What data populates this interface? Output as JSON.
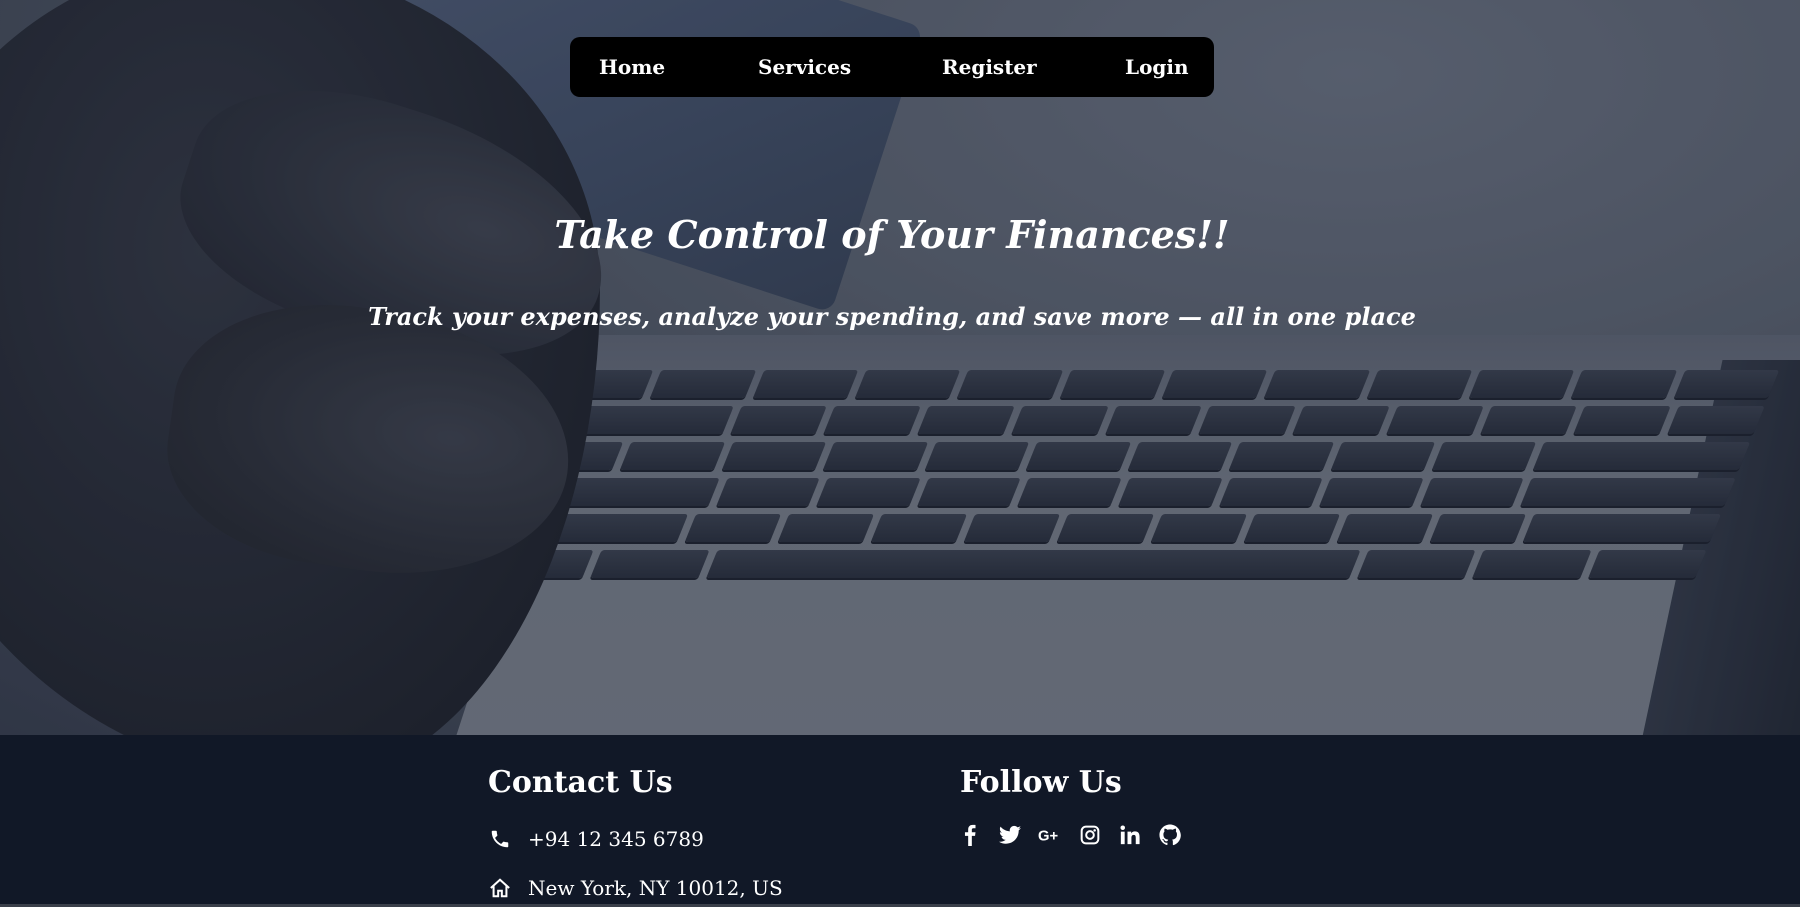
{
  "nav": {
    "items": [
      {
        "label": "Home"
      },
      {
        "label": "Services"
      },
      {
        "label": "Register"
      },
      {
        "label": "Login"
      }
    ]
  },
  "hero": {
    "title": "Take Control of Your Finances!!",
    "subtitle": "Track your expenses, analyze your spending, and save more — all in one place"
  },
  "footer": {
    "contact": {
      "heading": "Contact Us",
      "phone": "+94 12 345 6789",
      "address": "New York, NY 10012, US"
    },
    "follow": {
      "heading": "Follow Us",
      "icons": [
        "facebook-icon",
        "twitter-icon",
        "google-plus-icon",
        "instagram-icon",
        "linkedin-icon",
        "github-icon"
      ]
    }
  },
  "colors": {
    "nav_bg": "#000000",
    "footer_bg": "#111827",
    "text": "#ffffff"
  }
}
